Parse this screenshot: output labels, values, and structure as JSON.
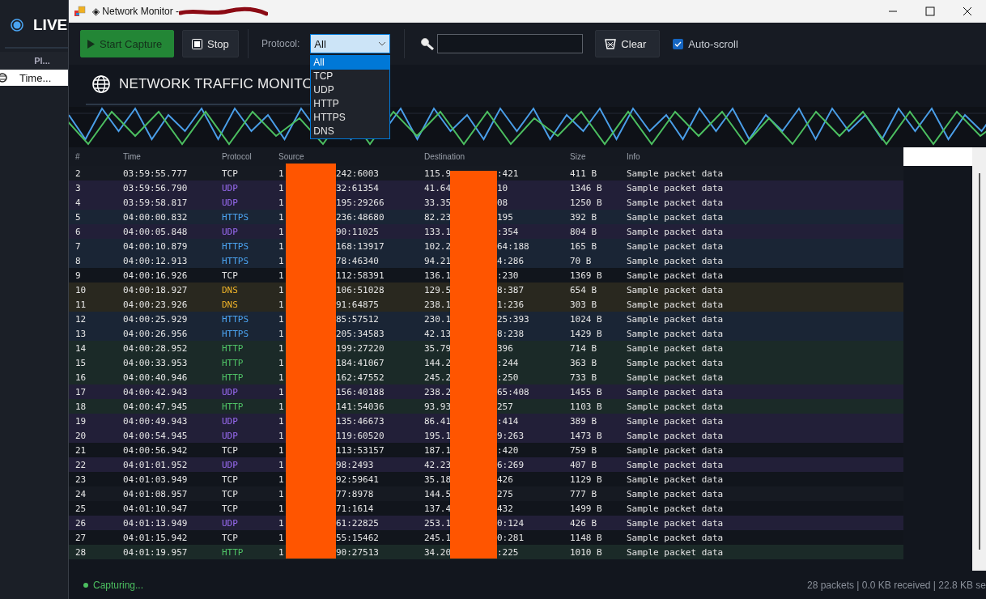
{
  "background_app": {
    "title": "LIVE",
    "column_header": "Pl...",
    "row": {
      "label": "Time...",
      "selected": true
    }
  },
  "window": {
    "title": "◈ Network Monitor -"
  },
  "toolbar": {
    "start_button": "Start Capture",
    "stop_button": "Stop",
    "protocol_filter": {
      "label": "Protocol:",
      "value": "All",
      "expanded": true,
      "options": [
        {
          "label": "All",
          "selected": true
        },
        {
          "label": "TCP",
          "selected": false
        },
        {
          "label": "UDP",
          "selected": false
        },
        {
          "label": "HTTP",
          "selected": false
        },
        {
          "label": "HTTPS",
          "selected": false
        },
        {
          "label": "DNS",
          "selected": false
        }
      ]
    },
    "clear_button": "Clear",
    "auto_scroll": {
      "label": "Auto-scroll",
      "checked": true
    }
  },
  "header": {
    "title": "NETWORK TRAFFIC MONITO"
  },
  "table": {
    "columns": [
      "#",
      "Time",
      "Protocol",
      "Source",
      "Destination",
      "Size",
      "Info"
    ],
    "rows": [
      {
        "num": "2",
        "time": "03:59:55.777",
        "kind": "tcp",
        "protocol": "TCP",
        "source": [
          "1",
          "242:6003"
        ],
        "destination": [
          "115.9",
          ":421"
        ],
        "size": "411 B",
        "info": "Sample packet data"
      },
      {
        "num": "3",
        "time": "03:59:56.790",
        "kind": "udp",
        "protocol": "UDP",
        "source": [
          "1",
          "32:61354"
        ],
        "destination": [
          "41.64",
          "10"
        ],
        "size": "1346 B",
        "info": "Sample packet data"
      },
      {
        "num": "4",
        "time": "03:59:58.817",
        "kind": "udp",
        "protocol": "UDP",
        "source": [
          "1",
          "195:29266"
        ],
        "destination": [
          "33.35",
          "08"
        ],
        "size": "1250 B",
        "info": "Sample packet data"
      },
      {
        "num": "5",
        "time": "04:00:00.832",
        "kind": "https",
        "protocol": "HTTPS",
        "source": [
          "1",
          "236:48680"
        ],
        "destination": [
          "82.23",
          "195"
        ],
        "size": "392 B",
        "info": "Sample packet data"
      },
      {
        "num": "6",
        "time": "04:00:05.848",
        "kind": "udp",
        "protocol": "UDP",
        "source": [
          "1",
          "90:11025"
        ],
        "destination": [
          "133.1",
          ":354"
        ],
        "size": "804 B",
        "info": "Sample packet data"
      },
      {
        "num": "7",
        "time": "04:00:10.879",
        "kind": "https",
        "protocol": "HTTPS",
        "source": [
          "1",
          "168:13917"
        ],
        "destination": [
          "102.2",
          "64:188"
        ],
        "size": "165 B",
        "info": "Sample packet data"
      },
      {
        "num": "8",
        "time": "04:00:12.913",
        "kind": "https",
        "protocol": "HTTPS",
        "source": [
          "1",
          "78:46340"
        ],
        "destination": [
          "94.21",
          "4:286"
        ],
        "size": "70 B",
        "info": "Sample packet data"
      },
      {
        "num": "9",
        "time": "04:00:16.926",
        "kind": "tcp",
        "protocol": "TCP",
        "source": [
          "1",
          "112:58391"
        ],
        "destination": [
          "136.1",
          ":230"
        ],
        "size": "1369 B",
        "info": "Sample packet data"
      },
      {
        "num": "10",
        "time": "04:00:18.927",
        "kind": "dns",
        "protocol": "DNS",
        "source": [
          "1",
          "106:51028"
        ],
        "destination": [
          "129.5",
          "8:387"
        ],
        "size": "654 B",
        "info": "Sample packet data"
      },
      {
        "num": "11",
        "time": "04:00:23.926",
        "kind": "dns",
        "protocol": "DNS",
        "source": [
          "1",
          "91:64875"
        ],
        "destination": [
          "238.1",
          "1:236"
        ],
        "size": "303 B",
        "info": "Sample packet data"
      },
      {
        "num": "12",
        "time": "04:00:25.929",
        "kind": "https",
        "protocol": "HTTPS",
        "source": [
          "1",
          "85:57512"
        ],
        "destination": [
          "230.1",
          "25:393"
        ],
        "size": "1024 B",
        "info": "Sample packet data"
      },
      {
        "num": "13",
        "time": "04:00:26.956",
        "kind": "https",
        "protocol": "HTTPS",
        "source": [
          "1",
          "205:34583"
        ],
        "destination": [
          "42.13",
          "8:238"
        ],
        "size": "1429 B",
        "info": "Sample packet data"
      },
      {
        "num": "14",
        "time": "04:00:28.952",
        "kind": "http",
        "protocol": "HTTP",
        "source": [
          "1",
          "199:27220"
        ],
        "destination": [
          "35.79",
          "396"
        ],
        "size": "714 B",
        "info": "Sample packet data"
      },
      {
        "num": "15",
        "time": "04:00:33.953",
        "kind": "http",
        "protocol": "HTTP",
        "source": [
          "1",
          "184:41067"
        ],
        "destination": [
          "144.2",
          ":244"
        ],
        "size": "363 B",
        "info": "Sample packet data"
      },
      {
        "num": "16",
        "time": "04:00:40.946",
        "kind": "http",
        "protocol": "HTTP",
        "source": [
          "1",
          "162:47552"
        ],
        "destination": [
          "245.2",
          ":250"
        ],
        "size": "733 B",
        "info": "Sample packet data"
      },
      {
        "num": "17",
        "time": "04:00:42.943",
        "kind": "udp",
        "protocol": "UDP",
        "source": [
          "1",
          "156:40188"
        ],
        "destination": [
          "238.2",
          "65:408"
        ],
        "size": "1455 B",
        "info": "Sample packet data"
      },
      {
        "num": "18",
        "time": "04:00:47.945",
        "kind": "http",
        "protocol": "HTTP",
        "source": [
          "1",
          "141:54036"
        ],
        "destination": [
          "93.93",
          "257"
        ],
        "size": "1103 B",
        "info": "Sample packet data"
      },
      {
        "num": "19",
        "time": "04:00:49.943",
        "kind": "udp",
        "protocol": "UDP",
        "source": [
          "1",
          "135:46673"
        ],
        "destination": [
          "86.41",
          ":414"
        ],
        "size": "389 B",
        "info": "Sample packet data"
      },
      {
        "num": "20",
        "time": "04:00:54.945",
        "kind": "udp",
        "protocol": "UDP",
        "source": [
          "1",
          "119:60520"
        ],
        "destination": [
          "195.1",
          "9:263"
        ],
        "size": "1473 B",
        "info": "Sample packet data"
      },
      {
        "num": "21",
        "time": "04:00:56.942",
        "kind": "tcp",
        "protocol": "TCP",
        "source": [
          "1",
          "113:53157"
        ],
        "destination": [
          "187.1",
          ":420"
        ],
        "size": "759 B",
        "info": "Sample packet data"
      },
      {
        "num": "22",
        "time": "04:01:01.952",
        "kind": "udp",
        "protocol": "UDP",
        "source": [
          "1",
          "98:2493"
        ],
        "destination": [
          "42.23",
          "6:269"
        ],
        "size": "407 B",
        "info": "Sample packet data"
      },
      {
        "num": "23",
        "time": "04:01:03.949",
        "kind": "tcp",
        "protocol": "TCP",
        "source": [
          "1",
          "92:59641"
        ],
        "destination": [
          "35.18",
          "426"
        ],
        "size": "1129 B",
        "info": "Sample packet data"
      },
      {
        "num": "24",
        "time": "04:01:08.957",
        "kind": "tcp",
        "protocol": "TCP",
        "source": [
          "1",
          "77:8978"
        ],
        "destination": [
          "144.5",
          "275"
        ],
        "size": "777 B",
        "info": "Sample packet data"
      },
      {
        "num": "25",
        "time": "04:01:10.947",
        "kind": "tcp",
        "protocol": "TCP",
        "source": [
          "1",
          "71:1614"
        ],
        "destination": [
          "137.4",
          "432"
        ],
        "size": "1499 B",
        "info": "Sample packet data"
      },
      {
        "num": "26",
        "time": "04:01:13.949",
        "kind": "udp",
        "protocol": "UDP",
        "source": [
          "1",
          "61:22825"
        ],
        "destination": [
          "253.1",
          "0:124"
        ],
        "size": "426 B",
        "info": "Sample packet data"
      },
      {
        "num": "27",
        "time": "04:01:15.942",
        "kind": "tcp",
        "protocol": "TCP",
        "source": [
          "1",
          "55:15462"
        ],
        "destination": [
          "245.1",
          "0:281"
        ],
        "size": "1148 B",
        "info": "Sample packet data"
      },
      {
        "num": "28",
        "time": "04:01:19.957",
        "kind": "http",
        "protocol": "HTTP",
        "source": [
          "1",
          "90:27513"
        ],
        "destination": [
          "34.20",
          ":225"
        ],
        "size": "1010 B",
        "info": "Sample packet data"
      }
    ]
  },
  "status_bar": {
    "state": "Capturing...",
    "stats": "28 packets | 0.0 KB received | 22.8 KB se"
  }
}
